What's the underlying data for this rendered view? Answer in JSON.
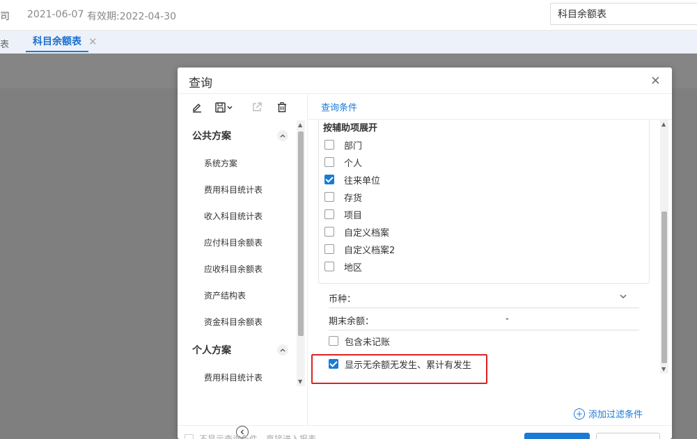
{
  "header": {
    "company_fragment": "司",
    "date": "2021-06-07",
    "validity": "有效期:2022-04-30",
    "search_value": "科目余额表"
  },
  "tabs": {
    "prev_fragment": "表",
    "active_label": "科目余额表",
    "close_glyph": "✕"
  },
  "dialog": {
    "title": "查询",
    "close_glyph": "×",
    "left": {
      "toolbar_icons": [
        "edit-icon",
        "save-dropdown-icon",
        "export-icon",
        "delete-icon"
      ],
      "public_group": {
        "title": "公共方案",
        "items": [
          "系统方案",
          "费用科目统计表",
          "收入科目统计表",
          "应付科目余额表",
          "应收科目余额表",
          "资产结构表",
          "资金科目余额表"
        ]
      },
      "personal_group": {
        "title": "个人方案",
        "items": [
          "费用科目统计表"
        ]
      }
    },
    "right": {
      "tab_label": "查询条件",
      "aux_title": "按辅助项展开",
      "aux_items": [
        {
          "label": "部门",
          "checked": false
        },
        {
          "label": "个人",
          "checked": false
        },
        {
          "label": "往来单位",
          "checked": true
        },
        {
          "label": "存货",
          "checked": false
        },
        {
          "label": "项目",
          "checked": false
        },
        {
          "label": "自定义档案",
          "checked": false
        },
        {
          "label": "自定义档案2",
          "checked": false
        },
        {
          "label": "地区",
          "checked": false
        }
      ],
      "currency_label": "币种：",
      "balance_label": "期末余额：",
      "balance_value": "-",
      "include_unposted": {
        "label": "包含未记账",
        "checked": false
      },
      "show_no_balance": {
        "label": "显示无余额无发生、累计有发生",
        "checked": true
      },
      "add_filter_label": "添加过滤条件"
    },
    "footer": {
      "text": "不显示查询条件，直接进入报表"
    }
  },
  "colors": {
    "accent": "#1a7ad6",
    "highlight": "#e02020",
    "overlay": "#7f7f7f"
  }
}
